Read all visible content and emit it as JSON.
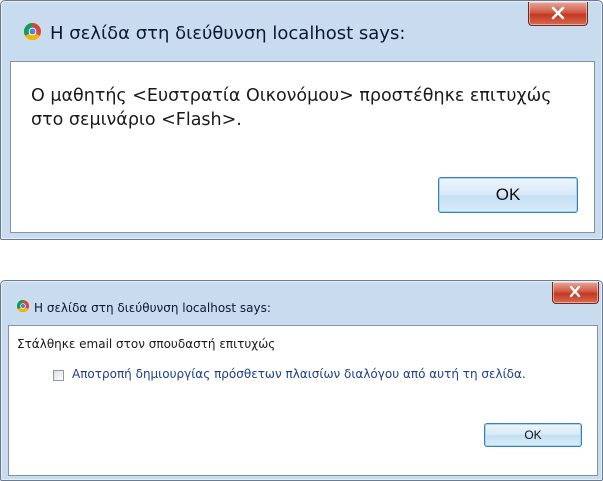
{
  "dialogs": [
    {
      "title": "Η σελίδα στη διεύθυνση localhost says:",
      "message": "Ο μαθητής <Ευστρατία Οικονόμου> προστέθηκε επιτυχώς στο σεμινάριο <Flash>.",
      "ok_label": "OK"
    },
    {
      "title": "Η σελίδα στη διεύθυνση localhost says:",
      "message": "Στάλθηκε email στον σπουδαστή επιτυχώς",
      "checkbox_label": "Αποτροπή δημιουργίας πρόσθετων πλαισίων διαλόγου από αυτή τη σελίδα.",
      "checkbox_checked": false,
      "ok_label": "OK"
    }
  ],
  "icons": {
    "app": "chrome-icon",
    "close": "close-x-icon"
  }
}
